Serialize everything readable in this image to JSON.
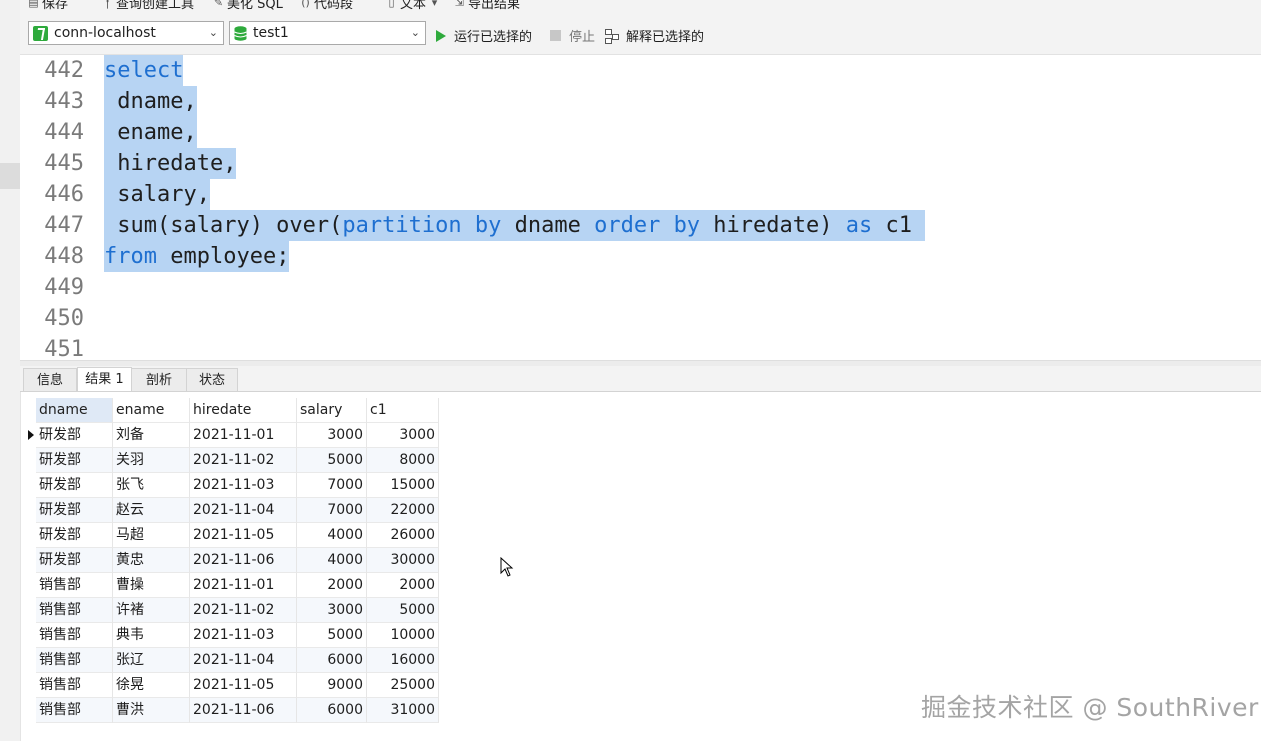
{
  "toolbar": {
    "items": [
      {
        "icon": "save-icon",
        "label": "保存"
      },
      {
        "icon": "query-builder-icon",
        "label": "查询创建工具"
      },
      {
        "icon": "beautify-icon",
        "label": "美化 SQL"
      },
      {
        "icon": "code-snippet-icon",
        "label": "代码段"
      },
      {
        "icon": "text-icon",
        "label": "文本"
      },
      {
        "icon": "export-icon",
        "label": "导出结果"
      }
    ]
  },
  "connection": {
    "connection_name": "conn-localhost",
    "database": "test1",
    "run_selected_label": "运行已选择的",
    "stop_label": "停止",
    "explain_selected_label": "解释已选择的"
  },
  "editor": {
    "lines": [
      {
        "no": "442",
        "tokens": [
          {
            "t": "select",
            "kw": true
          }
        ]
      },
      {
        "no": "443",
        "tokens": [
          {
            "t": " dname,"
          }
        ]
      },
      {
        "no": "444",
        "tokens": [
          {
            "t": " ename,"
          }
        ]
      },
      {
        "no": "445",
        "tokens": [
          {
            "t": " hiredate,"
          }
        ]
      },
      {
        "no": "446",
        "tokens": [
          {
            "t": " salary,"
          }
        ]
      },
      {
        "no": "447",
        "tokens": [
          {
            "t": " sum(salary) over("
          },
          {
            "t": "partition by",
            "kw": true
          },
          {
            "t": " dname "
          },
          {
            "t": "order by",
            "kw": true
          },
          {
            "t": " hiredate) "
          },
          {
            "t": "as",
            "kw": true
          },
          {
            "t": " c1 "
          }
        ]
      },
      {
        "no": "448",
        "tokens": [
          {
            "t": "from",
            "kw": true
          },
          {
            "t": " employee;"
          }
        ]
      },
      {
        "no": "449",
        "tokens": []
      },
      {
        "no": "450",
        "tokens": []
      },
      {
        "no": "451",
        "tokens": []
      }
    ]
  },
  "result_tabs": [
    {
      "label": "信息",
      "active": false
    },
    {
      "label": "结果 1",
      "active": true
    },
    {
      "label": "剖析",
      "active": false
    },
    {
      "label": "状态",
      "active": false
    }
  ],
  "result": {
    "columns": [
      "dname",
      "ename",
      "hiredate",
      "salary",
      "c1"
    ],
    "rows": [
      [
        "研发部",
        "刘备",
        "2021-11-01",
        "3000",
        "3000"
      ],
      [
        "研发部",
        "关羽",
        "2021-11-02",
        "5000",
        "8000"
      ],
      [
        "研发部",
        "张飞",
        "2021-11-03",
        "7000",
        "15000"
      ],
      [
        "研发部",
        "赵云",
        "2021-11-04",
        "7000",
        "22000"
      ],
      [
        "研发部",
        "马超",
        "2021-11-05",
        "4000",
        "26000"
      ],
      [
        "研发部",
        "黄忠",
        "2021-11-06",
        "4000",
        "30000"
      ],
      [
        "销售部",
        "曹操",
        "2021-11-01",
        "2000",
        "2000"
      ],
      [
        "销售部",
        "许褚",
        "2021-11-02",
        "3000",
        "5000"
      ],
      [
        "销售部",
        "典韦",
        "2021-11-03",
        "5000",
        "10000"
      ],
      [
        "销售部",
        "张辽",
        "2021-11-04",
        "6000",
        "16000"
      ],
      [
        "销售部",
        "徐晃",
        "2021-11-05",
        "9000",
        "25000"
      ],
      [
        "销售部",
        "曹洪",
        "2021-11-06",
        "6000",
        "31000"
      ]
    ]
  },
  "watermark": "掘金技术社区 @ SouthRiver",
  "colors": {
    "selection": "#b7d4f3",
    "keyword": "#1e6fd0",
    "run_icon": "#2eaa3c"
  }
}
